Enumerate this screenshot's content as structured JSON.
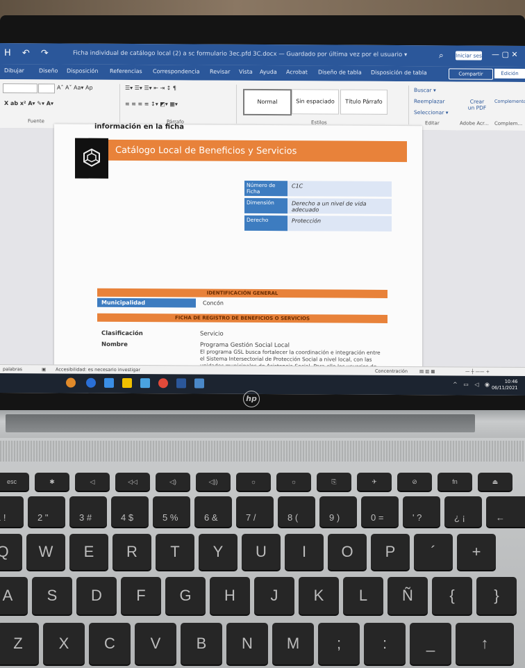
{
  "word": {
    "quick_access": "H ↶ ↷",
    "doc_title": "Ficha individual de catálogo local (2) a sc formulario 3ec.pfd 3C.docx — Guardado por última vez por el usuario ▾",
    "signin": "Iniciar ses",
    "tabs": [
      "Dibujar",
      "Diseño",
      "Disposición",
      "Referencias",
      "Correspondencia",
      "Revisar",
      "Vista",
      "Ayuda",
      "Acrobat",
      "Diseño de tabla",
      "Disposición de tabla"
    ],
    "share": "Compartir",
    "edit": "Edición",
    "font_sizes": "A˄ A˅ Aa▾ Ap",
    "styles": [
      "Normal",
      "Sin espaciado",
      "Título Párrafo"
    ],
    "group_labels": [
      "Fuente",
      "Párrafo",
      "Estilos",
      "Editar",
      "Adobe Acr...",
      "Complem..."
    ],
    "right_items": [
      "Buscar ▾",
      "Reemplazar",
      "Seleccionar ▾",
      "Crear un PDF",
      "Complementos"
    ]
  },
  "document": {
    "prev_line": "información en la ficha",
    "banner_title": "Catálogo Local de Beneficios y Servicios",
    "fields": [
      {
        "label": "Número de Ficha",
        "value": "C1C"
      },
      {
        "label": "Dimensión",
        "value": "Derecho a un nivel de vida adecuado"
      },
      {
        "label": "Derecho",
        "value": "Protección"
      }
    ],
    "section1": "IDENTIFICACIÓN GENERAL",
    "municipality_label": "Municipalidad",
    "municipality_value": "Concón",
    "section2": "FICHA DE REGISTRO DE BENEFICIOS O SERVICIOS",
    "rows": [
      {
        "label": "Clasificación",
        "value": "Servicio"
      },
      {
        "label": "Nombre",
        "value": "Programa Gestión Social Local"
      }
    ],
    "description": "El programa GSL busca fortalecer la coordinación e integración entre el Sistema Intersectorial de Protección Social a nivel local, con las unidades municipales de Asistencia Social. Para ello los usuarios de asistencia municipal, de RSH, Subsidios y el Programa Familias postulan en el SPS, entregan y almacenan toda la información de atenciones realizadas."
  },
  "statusbar": {
    "words": "palabras",
    "accessibility": "Accesibilidad: es necesario investigar",
    "focus": "Concentración"
  },
  "taskbar": {
    "time": "10:46",
    "date": "06/11/2021"
  },
  "brand": "hp",
  "keyboard": {
    "fn_row": [
      "esc",
      "✱",
      "◁",
      "◁◁",
      "◁)",
      "◁))",
      "☼",
      "☼",
      "⎘",
      "✈",
      "⊘",
      "fn",
      "⏏"
    ],
    "num_row": [
      [
        "!",
        "1"
      ],
      [
        "\"",
        "2"
      ],
      [
        "#",
        "3"
      ],
      [
        "$",
        "4"
      ],
      [
        "%",
        "5"
      ],
      [
        "&",
        "6"
      ],
      [
        "/",
        "7"
      ],
      [
        "(",
        "8"
      ],
      [
        ")",
        "9"
      ],
      [
        "=",
        "0"
      ],
      [
        "?",
        "'"
      ],
      [
        "¡",
        "¿"
      ],
      [
        "←",
        ""
      ]
    ],
    "top_row": [
      "Q",
      "W",
      "E",
      "R",
      "T",
      "Y",
      "U",
      "I",
      "O",
      "P",
      "´",
      "+"
    ],
    "home_row": [
      "A",
      "S",
      "D",
      "F",
      "G",
      "H",
      "J",
      "K",
      "L",
      "Ñ",
      "{",
      "}"
    ],
    "bottom_row": [
      "Z",
      "X",
      "C",
      "V",
      "B",
      "N",
      "M",
      ";",
      ":",
      "_",
      "↑"
    ]
  },
  "colors": {
    "word_blue": "#2b579a",
    "banner_orange": "#e8823a",
    "label_blue": "#3d7cc0"
  }
}
